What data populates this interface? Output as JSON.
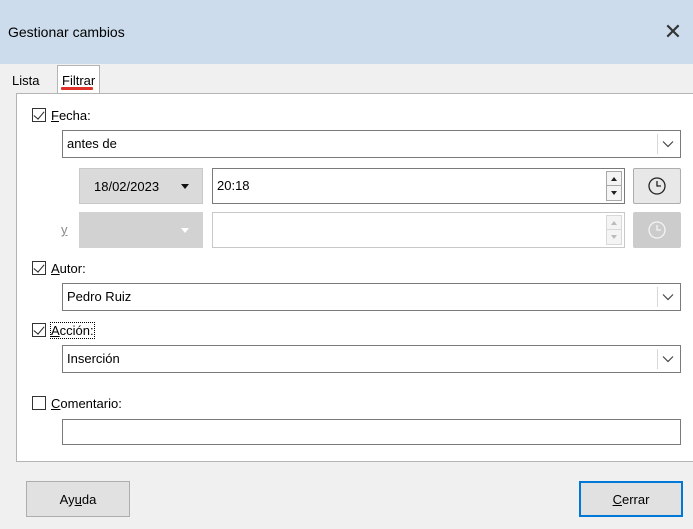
{
  "window": {
    "title": "Gestionar cambios",
    "close_glyph": "✕"
  },
  "tabs": [
    {
      "label": "Lista"
    },
    {
      "label": "Filtrar"
    }
  ],
  "filter": {
    "date": {
      "checked": true,
      "label_first": "F",
      "label_rest": "echa:",
      "condition": "antes de",
      "date_value": "18/02/2023",
      "time_value": "20:18",
      "and_label": "y"
    },
    "author": {
      "checked": true,
      "label_first": "A",
      "label_rest": "utor:",
      "value": "Pedro Ruiz"
    },
    "action": {
      "checked": true,
      "label_first": "A",
      "label_rest": "cción:",
      "value": "Inserción"
    },
    "comment": {
      "checked": false,
      "label_first": "C",
      "label_rest": "omentario:",
      "value": ""
    }
  },
  "buttons": {
    "help": {
      "pre": "Ay",
      "u": "u",
      "post": "da"
    },
    "close": {
      "pre": "",
      "u": "C",
      "post": "errar"
    }
  },
  "icons": {
    "clock": "clock-icon",
    "dropdown": "chevron-down-icon"
  },
  "colors": {
    "titlebar": "#ccdced",
    "tab_accent": "#e0312a",
    "default_button_border": "#0078d7"
  }
}
